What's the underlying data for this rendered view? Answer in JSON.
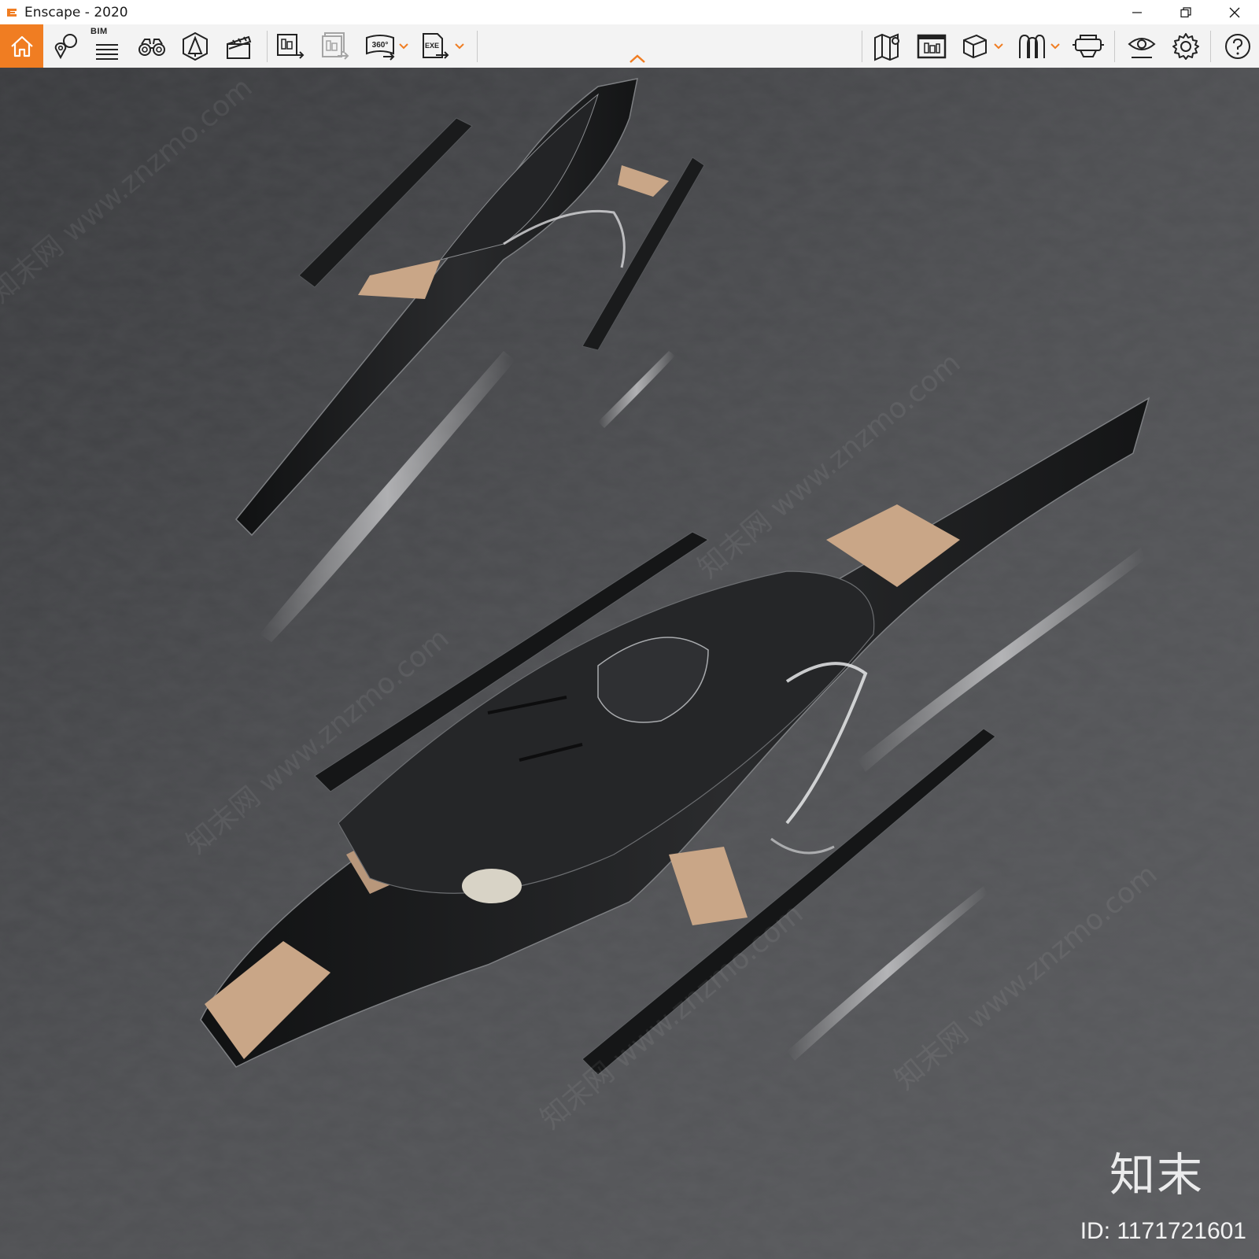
{
  "window": {
    "title": "Enscape - 2020",
    "accent_color": "#f07d22",
    "controls": [
      {
        "name": "minimize-icon"
      },
      {
        "name": "restore-icon"
      },
      {
        "name": "close-icon"
      }
    ]
  },
  "toolbar": {
    "bim_label": "BIM",
    "left_tools": [
      {
        "name": "home-icon",
        "active": true
      },
      {
        "name": "views-pin-icon"
      },
      {
        "name": "bim-list-icon"
      },
      {
        "name": "binoculars-icon"
      },
      {
        "name": "asset-library-icon"
      },
      {
        "name": "clapperboard-icon"
      },
      {
        "name": "screenshot-export-icon"
      },
      {
        "name": "batch-render-icon",
        "disabled": true
      },
      {
        "name": "panorama-360-icon",
        "has_dropdown": true,
        "label": "360°"
      },
      {
        "name": "exe-export-icon",
        "has_dropdown": true,
        "label": "EXE"
      }
    ],
    "right_tools": [
      {
        "name": "map-icon"
      },
      {
        "name": "screenshot-window-icon"
      },
      {
        "name": "cube-icon",
        "has_dropdown": true
      },
      {
        "name": "people-icon",
        "has_dropdown": true
      },
      {
        "name": "vr-headset-icon"
      },
      {
        "name": "visual-settings-eye-icon"
      },
      {
        "name": "settings-gear-icon"
      },
      {
        "name": "help-icon"
      }
    ]
  },
  "viewport": {
    "scene": "Two dark trimaran yachts with teak decks on rippled grey water, aerial view",
    "water_color": "#4a4b4e",
    "hull_color": "#1c1d1f",
    "deck_color": "#c9a687"
  },
  "watermark": {
    "logo_text": "知末",
    "id_text": "ID: 1171721601"
  }
}
